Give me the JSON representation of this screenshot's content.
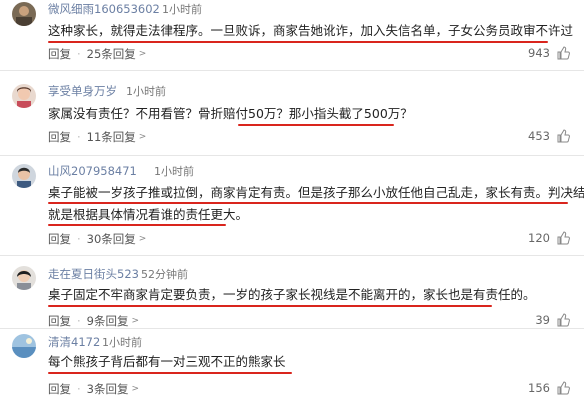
{
  "accent_color": "#d9251d",
  "comments": [
    {
      "username": "微风细雨160653602",
      "time": "1小时前",
      "text_lines": [
        "这种家长，就得走法律程序。一旦败诉，商家告她讹诈，加入失信名单，子女公务员政审不许过"
      ],
      "reply_label": "回复",
      "replies_label": "25条回复",
      "likes": "943"
    },
    {
      "username": "享受单身万岁",
      "time": "1小时前",
      "text_lines": [
        "家属没有责任？不用看管？骨折赔付50万？那小指头截了500万？"
      ],
      "reply_label": "回复",
      "replies_label": "11条回复",
      "likes": "453"
    },
    {
      "username": "山风207958471",
      "time": "1小时前",
      "text_lines": [
        "桌子能被一岁孩子推或拉倒，商家肯定有责。但是孩子那么小放任他自己乱走，家长有责。判决结果",
        "就是根据具体情况看谁的责任更大。"
      ],
      "reply_label": "回复",
      "replies_label": "30条回复",
      "likes": "120"
    },
    {
      "username": "走在夏日街头523",
      "time": "52分钟前",
      "text_lines": [
        "桌子固定不牢商家肯定要负责，一岁的孩子家长视线是不能离开的，家长也是有责任的。"
      ],
      "reply_label": "回复",
      "replies_label": "9条回复",
      "likes": "39"
    },
    {
      "username": "清清4172",
      "time": "1小时前",
      "text_lines": [
        "每个熊孩子背后都有一对三观不正的熊家长"
      ],
      "reply_label": "回复",
      "replies_label": "3条回复",
      "likes": "156"
    }
  ]
}
